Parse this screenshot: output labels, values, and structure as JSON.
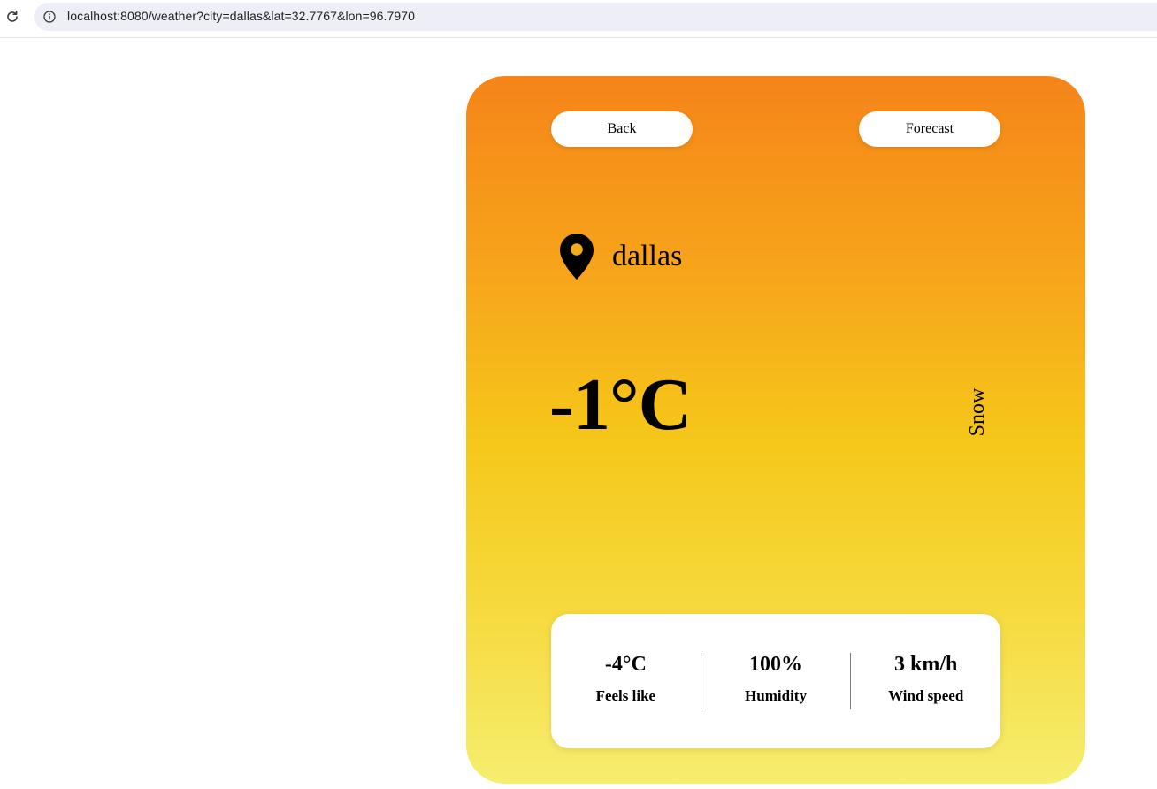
{
  "browser": {
    "url": "localhost:8080/weather?city=dallas&lat=32.7767&lon=96.7970"
  },
  "nav": {
    "back_label": "Back",
    "forecast_label": "Forecast"
  },
  "location": {
    "city": "dallas",
    "icon": "map-pin-icon"
  },
  "current": {
    "temperature": "-1°C",
    "condition": "Snow"
  },
  "stats": [
    {
      "value": "-4°C",
      "label": "Feels like"
    },
    {
      "value": "100%",
      "label": "Humidity"
    },
    {
      "value": "3 km/h",
      "label": "Wind speed"
    }
  ],
  "colors": {
    "card_gradient_top": "#f58419",
    "card_gradient_middle": "#f5c81a",
    "card_gradient_bottom": "#f6ee6f",
    "url_bar_bg": "#edeef6"
  }
}
